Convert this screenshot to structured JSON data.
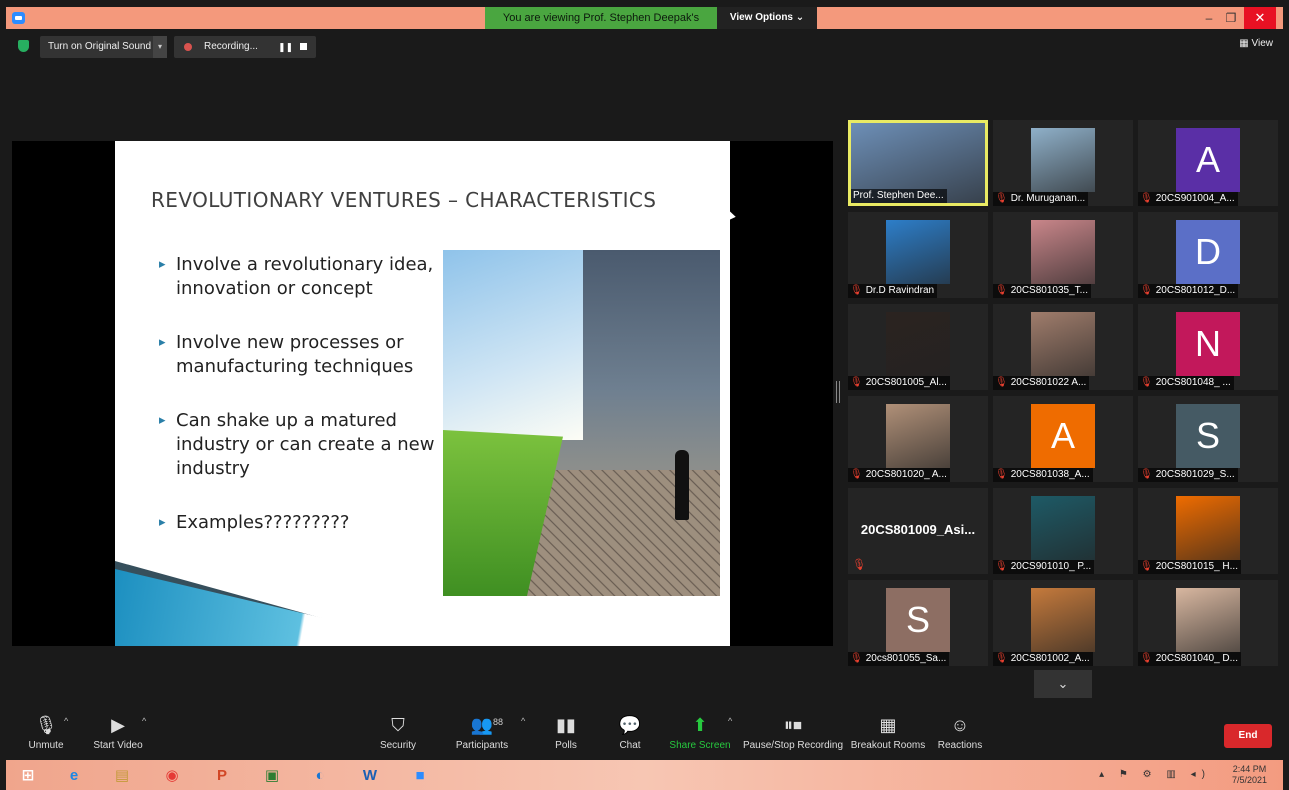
{
  "window": {
    "viewing_banner": "You are viewing Prof. Stephen Deepak's screen",
    "view_options": "View Options ⌄",
    "minimize": "–",
    "restore": "❐",
    "close": "✕"
  },
  "topbar": {
    "original_sound": "Turn on Original Sound",
    "recording": "Recording...",
    "pause_icon": "❚❚",
    "view": "▦ View"
  },
  "slide": {
    "title": "REVOLUTIONARY VENTURES – CHARACTERISTICS",
    "bullets": [
      "Involve a revolutionary idea, innovation or concept",
      "Involve new processes or manufacturing techniques",
      "Can shake up a matured industry or can create a new industry",
      "Examples?????????"
    ]
  },
  "gallery": {
    "tiles": [
      {
        "name": "Prof. Stephen Dee...",
        "muted": false,
        "kind": "photo",
        "active": true,
        "color": "#6d8fb7"
      },
      {
        "name": "Dr. Muruganan...",
        "muted": true,
        "kind": "photo",
        "color": "#8fb0c9"
      },
      {
        "name": "20CS901004_A...",
        "muted": true,
        "kind": "letter",
        "letter": "A",
        "color": "#5a2fa6"
      },
      {
        "name": "Dr.D Ravindran",
        "muted": true,
        "kind": "photo",
        "color": "#2d7ec9"
      },
      {
        "name": "20CS801035_T...",
        "muted": true,
        "kind": "photo",
        "color": "#c9868a"
      },
      {
        "name": "20CS801012_D...",
        "muted": true,
        "kind": "letter",
        "letter": "D",
        "color": "#5b6fc7"
      },
      {
        "name": "20CS801005_Al...",
        "muted": true,
        "kind": "photo",
        "color": "#2b2320"
      },
      {
        "name": "20CS801022 A...",
        "muted": true,
        "kind": "photo",
        "color": "#a07d6c"
      },
      {
        "name": "20CS801048_ ...",
        "muted": true,
        "kind": "letter",
        "letter": "N",
        "color": "#c2185b"
      },
      {
        "name": "20CS801020_ A...",
        "muted": true,
        "kind": "photo",
        "color": "#b09078"
      },
      {
        "name": "20CS801038_A...",
        "muted": true,
        "kind": "letter",
        "letter": "A",
        "color": "#ef6c00"
      },
      {
        "name": "20CS801029_S...",
        "muted": true,
        "kind": "letter",
        "letter": "S",
        "color": "#455a64"
      },
      {
        "name": "",
        "muted": true,
        "kind": "bigname",
        "bigname": "20CS801009_Asi...",
        "color": "#242424"
      },
      {
        "name": "20CS901010_ P...",
        "muted": true,
        "kind": "photo",
        "color": "#1e5a66"
      },
      {
        "name": "20CS801015_ H...",
        "muted": true,
        "kind": "photo",
        "color": "#ef6c00"
      },
      {
        "name": "20cs801055_Sa...",
        "muted": true,
        "kind": "letter",
        "letter": "S",
        "color": "#8d6e63"
      },
      {
        "name": "20CS801002_A...",
        "muted": true,
        "kind": "photo",
        "color": "#c57a3c"
      },
      {
        "name": "20CS801040_ D...",
        "muted": true,
        "kind": "photo",
        "color": "#d8b7a0"
      }
    ],
    "more": "⌄"
  },
  "toolbar": {
    "unmute": "Unmute",
    "start_video": "Start Video",
    "security": "Security",
    "participants": "Participants",
    "participant_count": "88",
    "polls": "Polls",
    "chat": "Chat",
    "share_screen": "Share Screen",
    "pause_recording": "Pause/Stop Recording",
    "breakout": "Breakout Rooms",
    "reactions": "Reactions",
    "end": "End"
  },
  "taskbar": {
    "time": "2:44 PM",
    "date": "7/5/2021"
  },
  "colors": {
    "title_bar": "#f4997c",
    "banner_green": "#4aa640",
    "end_red": "#d9282b",
    "active_speaker": "#e9ea63",
    "mute_red": "#e8402f",
    "share_green": "#27c93f"
  }
}
